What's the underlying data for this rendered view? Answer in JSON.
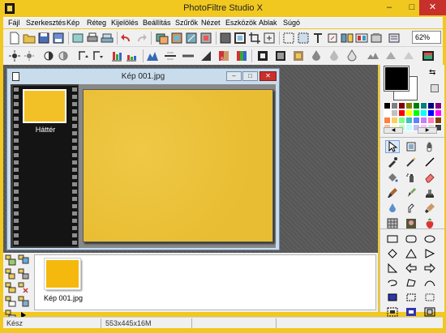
{
  "app": {
    "title": "PhotoFiltre Studio X",
    "minimize": "–",
    "maximize": "□",
    "close": "✕"
  },
  "menu": [
    "Fájl",
    "Szerkesztés",
    "Kép",
    "Réteg",
    "Kijelölés",
    "Beállítás",
    "Szűrők",
    "Nézet",
    "Eszközök",
    "Ablak",
    "Súgó"
  ],
  "toolbar": {
    "zoom": "62%"
  },
  "document": {
    "title": "Kép 001.jpg",
    "layer_label": "Háttér"
  },
  "palette": {
    "foreground": "#000000",
    "background": "#ffffff",
    "swatches": [
      "#000000",
      "#808080",
      "#800000",
      "#808000",
      "#008000",
      "#008080",
      "#000080",
      "#800080",
      "#ffffff",
      "#c0c0c0",
      "#ff0000",
      "#ffff00",
      "#00ff00",
      "#00ffff",
      "#0000ff",
      "#ff00ff",
      "#ff8040",
      "#ffcc66",
      "#80ff80",
      "#40c0c0",
      "#6080ff",
      "#c080ff",
      "#ff80c0",
      "#804000",
      "#ffc0a0",
      "#ffffc0",
      "#c0ffc0",
      "#c0ffff",
      "#c0c0ff",
      "#ffc0ff",
      "#e0e0e0",
      "#404040"
    ]
  },
  "thumbnails": [
    {
      "label": "Kép 001.jpg",
      "color": "#f5b90e"
    }
  ],
  "status": {
    "state": "Kész",
    "dimensions": "553x445x16M"
  }
}
